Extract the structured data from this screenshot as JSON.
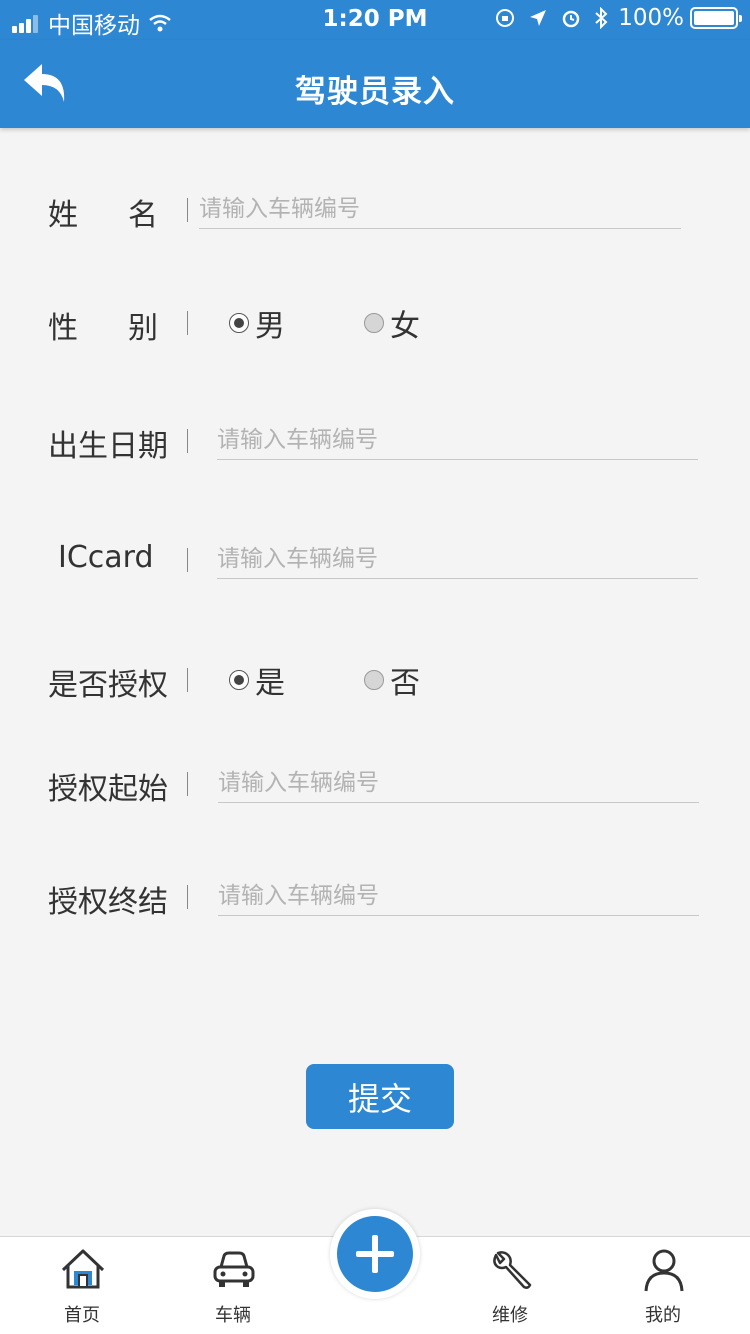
{
  "status_bar": {
    "carrier": "中国移动",
    "time": "1:20 PM",
    "battery": "100%"
  },
  "header": {
    "title": "驾驶员录入",
    "back_icon": "back-arrow-icon"
  },
  "form": {
    "name": {
      "label": "姓名",
      "placeholder": "请输入车辆编号"
    },
    "gender": {
      "label": "性别",
      "options": [
        "男",
        "女"
      ],
      "selected": "男"
    },
    "birthdate": {
      "label": "出生日期",
      "placeholder": "请输入车辆编号"
    },
    "iccard": {
      "label": "ICcard",
      "placeholder": "请输入车辆编号"
    },
    "authorized": {
      "label": "是否授权",
      "options": [
        "是",
        "否"
      ],
      "selected": "是"
    },
    "auth_start": {
      "label": "授权起始",
      "placeholder": "请输入车辆编号"
    },
    "auth_end": {
      "label": "授权终结",
      "placeholder": "请输入车辆编号"
    },
    "submit_label": "提交"
  },
  "tabbar": {
    "items": [
      {
        "label": "首页",
        "icon": "home-icon"
      },
      {
        "label": "车辆",
        "icon": "car-icon"
      },
      {
        "label": "",
        "icon": "plus-icon"
      },
      {
        "label": "维修",
        "icon": "wrench-icon"
      },
      {
        "label": "我的",
        "icon": "user-icon"
      }
    ]
  },
  "colors": {
    "primary": "#2d87d3",
    "background": "#f4f4f4"
  }
}
